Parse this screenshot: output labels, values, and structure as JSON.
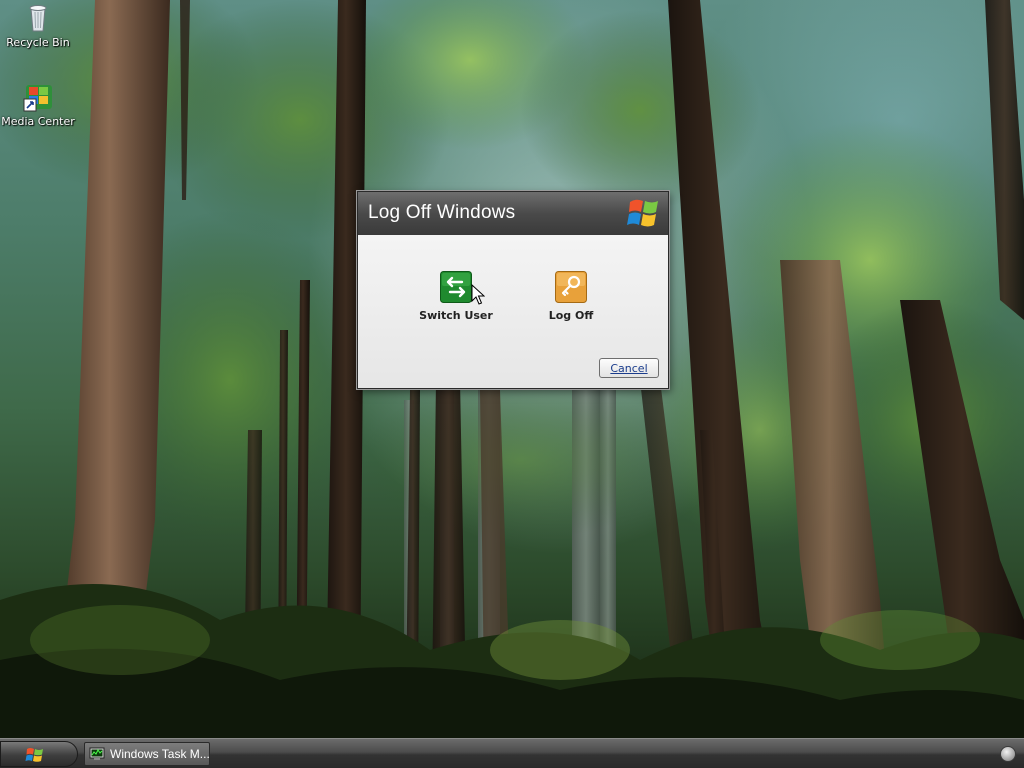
{
  "desktop": {
    "icons": [
      {
        "label": "Recycle Bin",
        "icon": "recycle-bin-icon"
      },
      {
        "label": "Media Center",
        "icon": "media-center-icon"
      }
    ]
  },
  "dialog": {
    "title": "Log Off Windows",
    "logo": "windows-xp-logo",
    "actions": [
      {
        "label": "Switch User",
        "icon": "switch-user-icon",
        "color": "#1f8a2e"
      },
      {
        "label": "Log Off",
        "icon": "log-off-key-icon",
        "color": "#e8a13a"
      }
    ],
    "cancel_label": "Cancel"
  },
  "taskbar": {
    "start_icon": "windows-flag-icon",
    "tasks": [
      {
        "label": "Windows Task M...",
        "icon": "task-manager-icon"
      }
    ],
    "tray_icon": "tray-circle-icon"
  }
}
